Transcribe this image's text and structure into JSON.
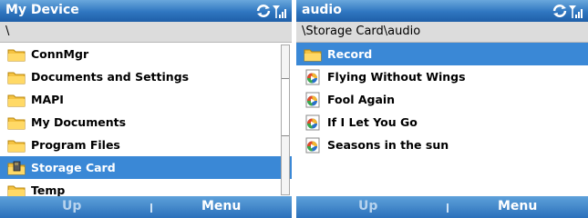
{
  "colors": {
    "title_bar": "#2f76c0",
    "selection": "#3a88d6",
    "path_bar": "#dcdcdc",
    "folder": "#f5c342"
  },
  "screens": [
    {
      "title": "My Device",
      "path": "\\",
      "items": [
        {
          "label": "ConnMgr",
          "icon": "folder-icon",
          "selected": false
        },
        {
          "label": "Documents and Settings",
          "icon": "folder-icon",
          "selected": false
        },
        {
          "label": "MAPI",
          "icon": "folder-icon",
          "selected": false
        },
        {
          "label": "My Documents",
          "icon": "folder-icon",
          "selected": false
        },
        {
          "label": "Program Files",
          "icon": "folder-icon",
          "selected": false
        },
        {
          "label": "Storage Card",
          "icon": "storage-card-folder-icon",
          "selected": true
        },
        {
          "label": "Temp",
          "icon": "folder-icon",
          "selected": false
        }
      ],
      "softkeys": {
        "left": "Up",
        "right": "Menu"
      }
    },
    {
      "title": "audio",
      "path": "\\Storage Card\\audio",
      "items": [
        {
          "label": "Record",
          "icon": "folder-icon",
          "selected": true
        },
        {
          "label": "Flying Without Wings",
          "icon": "media-file-icon",
          "selected": false
        },
        {
          "label": "Fool Again",
          "icon": "media-file-icon",
          "selected": false
        },
        {
          "label": "If I Let You Go",
          "icon": "media-file-icon",
          "selected": false
        },
        {
          "label": "Seasons in the sun",
          "icon": "media-file-icon",
          "selected": false
        }
      ],
      "softkeys": {
        "left": "Up",
        "right": "Menu"
      }
    }
  ]
}
